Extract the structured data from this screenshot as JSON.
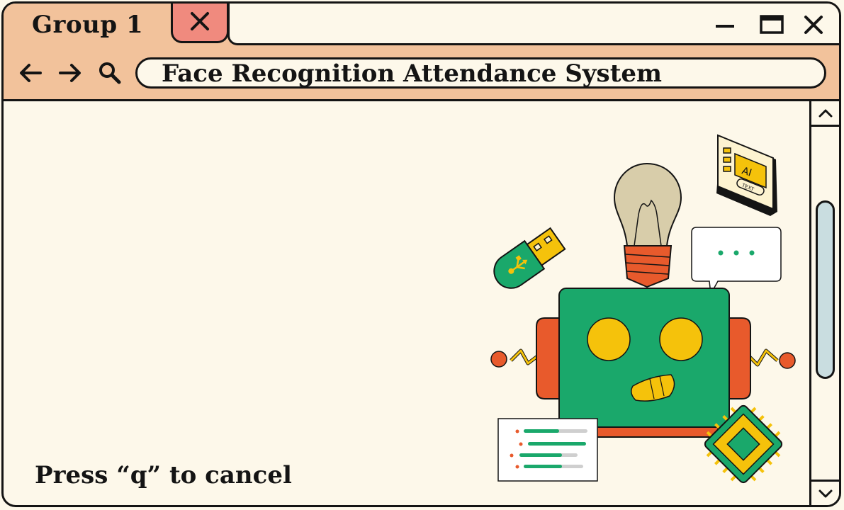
{
  "tab": {
    "label": "Group 1"
  },
  "address_bar": {
    "value": "Face Recognition Attendance System"
  },
  "content": {
    "cancel_hint": "Press “q” to cancel"
  },
  "illustration": {
    "ai_badge": "AI",
    "text_badge": "TEXT"
  },
  "icons": {
    "tab_close": "close-icon",
    "minimize": "minimize-icon",
    "maximize": "maximize-icon",
    "close_window": "close-icon",
    "back": "arrow-left-icon",
    "forward": "arrow-right-icon",
    "search": "search-icon",
    "scroll_up": "chevron-up-icon",
    "scroll_down": "chevron-down-icon"
  },
  "colors": {
    "header_bg": "#f2c29b",
    "page_bg": "#fdf8ea",
    "tab_close_bg": "#f08a7e",
    "scroll_thumb": "#c9dde0",
    "robot_green": "#1aa86b",
    "robot_yellow": "#f5c20b",
    "robot_red": "#e85a2c"
  }
}
